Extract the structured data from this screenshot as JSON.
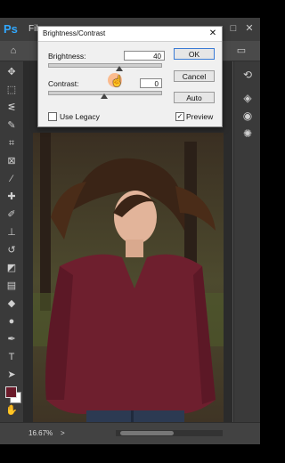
{
  "app": {
    "logo": "Ps",
    "menu": [
      "File"
    ],
    "window_controls": [
      "–",
      "□",
      "✕"
    ]
  },
  "dialog": {
    "title": "Brightness/Contrast",
    "close": "✕",
    "brightness": {
      "label": "Brightness:",
      "value": "40"
    },
    "contrast": {
      "label": "Contrast:",
      "value": "0"
    },
    "buttons": {
      "ok": "OK",
      "cancel": "Cancel",
      "auto": "Auto"
    },
    "use_legacy": {
      "label": "Use Legacy",
      "checked": false
    },
    "preview": {
      "label": "Preview",
      "checked": true
    }
  },
  "status": {
    "zoom": "16.67%"
  },
  "colors": {
    "foreground": "#6a1a2a",
    "background": "#ffffff"
  }
}
